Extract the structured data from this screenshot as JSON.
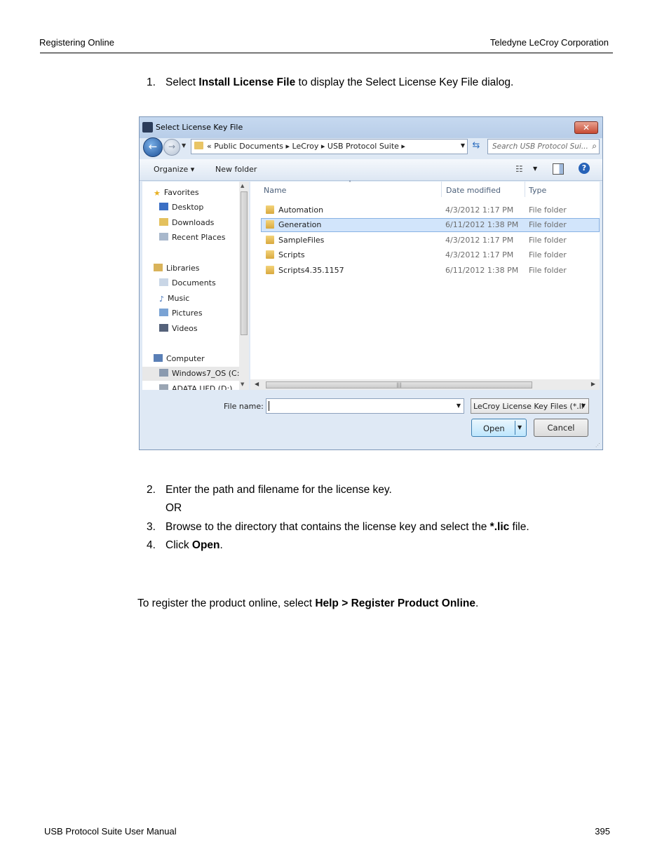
{
  "header": {
    "left": "Registering Online",
    "right": "Teledyne  LeCroy Corporation"
  },
  "footer": {
    "left": "USB Protocol Suite User Manual",
    "right": "395"
  },
  "steps": {
    "s1": {
      "num": "1.",
      "pre": "Select ",
      "bold": "Install License File",
      "post": " to display the Select License Key File dialog."
    },
    "s2": {
      "num": "2.",
      "text": "Enter the path and filename for the license key."
    },
    "or": "OR",
    "s3": {
      "num": "3.",
      "pre": "Browse to the directory that contains the license key and select the ",
      "bold": "*.lic",
      "post": " file."
    },
    "s4": {
      "num": "4.",
      "pre": "Click ",
      "bold": "Open",
      "post": "."
    }
  },
  "register": {
    "pre": "To register the product online, select ",
    "bold": "Help > Register Product Online",
    "post": "."
  },
  "dialog": {
    "title": "Select License Key File",
    "close": "✕",
    "address": "«  Public Documents  ▸  LeCroy  ▸  USB Protocol Suite  ▸",
    "search_placeholder": "Search USB Protocol Sui...",
    "toolbar": {
      "organize": "Organize ▾",
      "new_folder": "New folder"
    },
    "nav": {
      "favorites": "Favorites",
      "desktop": "Desktop",
      "downloads": "Downloads",
      "recent": "Recent Places",
      "libraries": "Libraries",
      "documents": "Documents",
      "music": "Music",
      "pictures": "Pictures",
      "videos": "Videos",
      "computer": "Computer",
      "win7": "Windows7_OS (C:",
      "adata": "ADATA UFD (D:)"
    },
    "columns": {
      "name": "Name",
      "date": "Date modified",
      "type": "Type"
    },
    "rows": [
      {
        "name": "Automation",
        "date": "4/3/2012 1:17 PM",
        "type": "File folder"
      },
      {
        "name": "Generation",
        "date": "6/11/2012 1:38 PM",
        "type": "File folder"
      },
      {
        "name": "SampleFiles",
        "date": "4/3/2012 1:17 PM",
        "type": "File folder"
      },
      {
        "name": "Scripts",
        "date": "4/3/2012 1:17 PM",
        "type": "File folder"
      },
      {
        "name": "Scripts4.35.1157",
        "date": "6/11/2012 1:38 PM",
        "type": "File folder"
      }
    ],
    "file_name_label": "File name:",
    "file_name_value": "",
    "file_type": "LeCroy License Key Files (*.li",
    "open": "Open",
    "cancel": "Cancel"
  }
}
